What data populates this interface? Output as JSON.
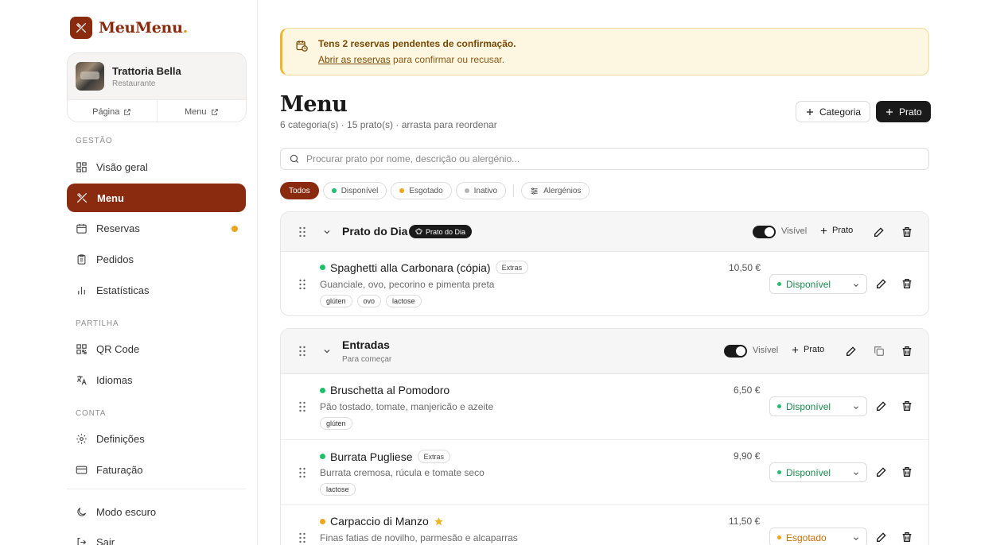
{
  "brand": {
    "name": "MeuMenu",
    "dot": "."
  },
  "restaurant": {
    "name": "Trattoria Bella",
    "type": "Restaurante",
    "links": [
      "Página",
      "Menu"
    ]
  },
  "sidebar": {
    "sections": [
      "GESTÃO",
      "PARTILHA",
      "CONTA"
    ],
    "items": [
      {
        "label": "Visão geral",
        "icon": "grid-icon"
      },
      {
        "label": "Menu",
        "icon": "utensils-icon",
        "active": true
      },
      {
        "label": "Reservas",
        "icon": "calendar-icon",
        "notification": true
      },
      {
        "label": "Pedidos",
        "icon": "clipboard-icon"
      },
      {
        "label": "Estatísticas",
        "icon": "bar-chart-icon"
      },
      {
        "label": "QR Code",
        "icon": "qr-icon"
      },
      {
        "label": "Idiomas",
        "icon": "translate-icon"
      },
      {
        "label": "Definições",
        "icon": "gear-icon"
      },
      {
        "label": "Faturação",
        "icon": "card-icon"
      },
      {
        "label": "Modo escuro",
        "icon": "moon-icon"
      },
      {
        "label": "Sair",
        "icon": "logout-icon"
      }
    ]
  },
  "alert": {
    "title": "Tens 2 reservas pendentes de confirmação.",
    "link": "Abrir as reservas",
    "rest": " para confirmar ou recusar."
  },
  "page": {
    "title": "Menu",
    "subtitle": "6 categoria(s) · 15 prato(s) · arrasta para reordenar",
    "add_category": "Categoria",
    "add_dish": "Prato"
  },
  "search": {
    "placeholder": "Procurar prato por nome, descrição ou alergénio..."
  },
  "filters": {
    "all": "Todos",
    "available": "Disponível",
    "sold_out": "Esgotado",
    "inactive": "Inativo",
    "allergens": "Alergénios"
  },
  "colors": {
    "accent": "#8a2a0e",
    "available": "#1fbf6b",
    "sold_out": "#f0a41c",
    "inactive": "#b5b5b5"
  },
  "common": {
    "visible": "Visível",
    "add_dish": "Prato",
    "extras": "Extras"
  },
  "categories": [
    {
      "title": "Prato do Dia",
      "badge": "Prato do Dia",
      "items": [
        {
          "name": "Spaghetti alla Carbonara (cópia)",
          "extras": true,
          "desc": "Guanciale, ovo, pecorino e pimenta preta",
          "tags": [
            "glúten",
            "ovo",
            "lactose"
          ],
          "price": "10,50 €",
          "status": "Disponível"
        }
      ]
    },
    {
      "title": "Entradas",
      "desc": "Para começar",
      "items": [
        {
          "name": "Bruschetta al Pomodoro",
          "desc": "Pão tostado, tomate, manjericão e azeite",
          "tags": [
            "glúten"
          ],
          "price": "6,50 €",
          "status": "Disponível"
        },
        {
          "name": "Burrata Pugliese",
          "extras": true,
          "desc": "Burrata cremosa, rúcula e tomate seco",
          "tags": [
            "lactose"
          ],
          "price": "9,90 €",
          "status": "Disponível"
        },
        {
          "name": "Carpaccio di Manzo",
          "featured": true,
          "desc": "Finas fatias de novilho, parmesão e alcaparras",
          "price": "11,50 €",
          "status": "Esgotado"
        }
      ]
    }
  ]
}
